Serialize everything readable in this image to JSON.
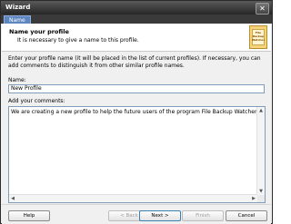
{
  "window": {
    "title": "Wizard",
    "close_glyph": "✕"
  },
  "tabs": [
    {
      "label": "Name"
    }
  ],
  "header": {
    "title": "Name your profile",
    "subtitle": "It is necessary to give a name to this profile.",
    "logo_text": "File Backup Watcher"
  },
  "content": {
    "description": "Enter your profile name (it will be placed in the list of current profiles). If necessary, you can add comments to distinguish it from other similar profile names.",
    "name_label": "Name:",
    "name_value": "New Profile",
    "comments_label": "Add your comments:",
    "comments_value": "We are creating a new profile to help the future users of the program File Backup Watcher."
  },
  "scrollbars": {
    "up": "▲",
    "down": "▼",
    "left": "◀",
    "right": "▶"
  },
  "footer": {
    "help_label": "Help",
    "back_label": "< Back",
    "next_label": "Next >",
    "finish_label": "Finish",
    "cancel_label": "Cancel"
  },
  "colors": {
    "titlebar": "#262626",
    "tab": "#5d86c0",
    "input_border": "#7f9db9"
  },
  "icons": {
    "close": "close-icon",
    "logo": "app-logo"
  }
}
